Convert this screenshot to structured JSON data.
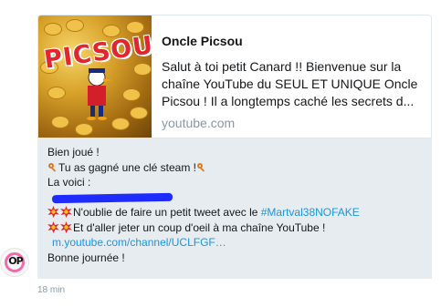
{
  "card": {
    "logo_text": "PICSOU",
    "title": "Oncle Picsou",
    "description": "Salut à toi petit Canard !! Bienvenue sur la chaîne YouTube du SEUL ET UNIQUE Oncle Picsou ! Il a longtemps caché les secrets d...",
    "domain": "youtube.com"
  },
  "message": {
    "line1": "Bien joué !",
    "line2": "Tu as gagné une clé steam !",
    "line3": "La voici :",
    "line5_prefix": "N'oublie de faire un petit tweet avec le ",
    "hashtag": "#Martval38NOFAKE",
    "line6": "Et d'aller jeter un coup d'oeil à ma chaîne YouTube !",
    "link": "m.youtube.com/channel/UCLFGF…",
    "line8": "Bonne journée !"
  },
  "avatar": {
    "text": "OP"
  },
  "timestamp": "18 min",
  "colors": {
    "link": "#1b95e0",
    "message_bg": "#e6ecf0",
    "redaction": "#1f2cff",
    "muted": "#8899a6"
  },
  "icons": [
    "key-emoji",
    "collision-emoji"
  ]
}
